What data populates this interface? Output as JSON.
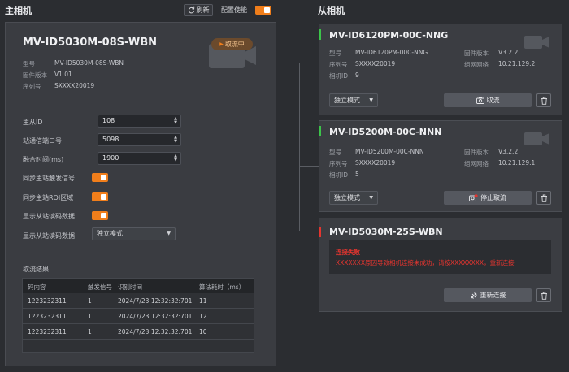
{
  "master": {
    "title": "主相机",
    "refresh_label": "刷新",
    "config_label": "配置使能",
    "camera": {
      "name": "MV-ID5030M-08S-WBN",
      "status": "取流中",
      "fields": [
        {
          "label": "型号",
          "value": "MV-ID5030M-08S-WBN"
        },
        {
          "label": "固件版本",
          "value": "V1.01"
        },
        {
          "label": "序列号",
          "value": "SXXXX20019"
        }
      ]
    },
    "form": {
      "master_slave_id": {
        "label": "主从ID",
        "value": "108"
      },
      "station_port": {
        "label": "站通信端口号",
        "value": "5098"
      },
      "merge_time": {
        "label": "融合时间(ms)",
        "value": "1900"
      },
      "sync_trigger": {
        "label": "同步主站触发信号",
        "on": true
      },
      "sync_roi": {
        "label": "同步主站ROI区域",
        "on": true
      },
      "show_slave_code": {
        "label": "显示从站读码数据",
        "on": true
      },
      "show_slave_code_mode": {
        "label": "显示从站读码数据",
        "value": "独立模式"
      }
    },
    "results": {
      "label": "取流结果",
      "columns": [
        "码内容",
        "触发信号",
        "识别时间",
        "算法耗时（ms）"
      ],
      "rows": [
        [
          "1223232311",
          "1",
          "2024/7/23 12:32:32:701",
          "11"
        ],
        [
          "1223232311",
          "1",
          "2024/7/23 12:32:32:701",
          "12"
        ],
        [
          "1223232311",
          "1",
          "2024/7/23 12:32:32:701",
          "10"
        ]
      ]
    }
  },
  "slaves": {
    "title": "从相机",
    "items": [
      {
        "name": "MV-ID6120PM-00C-NNG",
        "status_color": "#3cc44a",
        "model_label": "型号",
        "model": "MV-ID6120PM-00C-NNG",
        "fw_label": "固件版本",
        "fw": "V3.2.2",
        "sn_label": "序列号",
        "sn": "SXXXX20019",
        "net_label": "组网网络",
        "net": "10.21.129.2",
        "cid_label": "相机ID",
        "cid": "9",
        "mode": "独立模式",
        "action": "取流"
      },
      {
        "name": "MV-ID5200M-00C-NNN",
        "status_color": "#3cc44a",
        "model_label": "型号",
        "model": "MV-ID5200M-00C-NNN",
        "fw_label": "固件版本",
        "fw": "V3.2.2",
        "sn_label": "序列号",
        "sn": "SXXXX20019",
        "net_label": "组网网络",
        "net": "10.21.129.1",
        "cid_label": "相机ID",
        "cid": "5",
        "mode": "独立模式",
        "action": "停止取流"
      },
      {
        "name": "MV-ID5030M-25S-WBN",
        "status_color": "#e5352f",
        "error_title": "连接失败",
        "error_msg": "XXXXXXX原因导致相机连接未成功，请按XXXXXXXX，重新连接",
        "action": "重新连接"
      }
    ]
  },
  "colors": {
    "accent": "#f07e1b",
    "online": "#3cc44a",
    "error": "#e5352f"
  }
}
